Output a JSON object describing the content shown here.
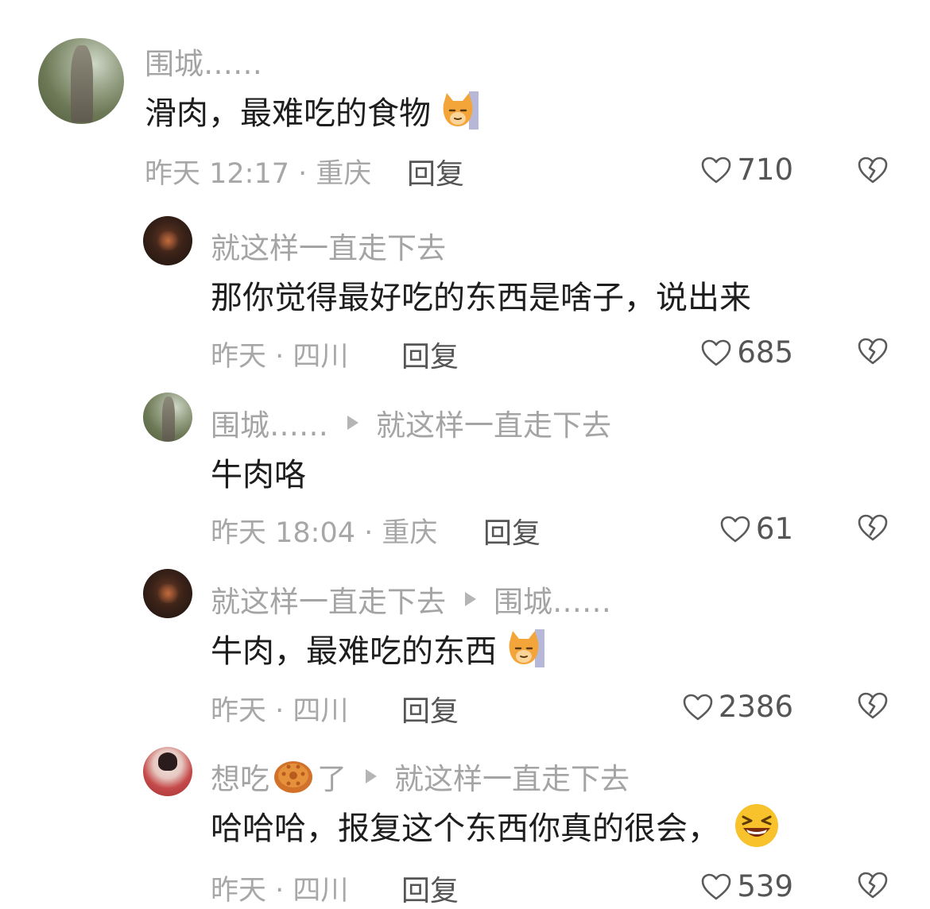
{
  "comments": [
    {
      "author": "围城……",
      "reply_to": "",
      "text": "滑肉，最难吃的食物",
      "time_location": "昨天 12:17 · 重庆",
      "reply_label": "回复",
      "likes": "710",
      "emoji": "cat-face-emoji"
    },
    {
      "author": "就这样一直走下去",
      "reply_to": "",
      "text": "那你觉得最好吃的东西是啥子，说出来",
      "time_location": "昨天 · 四川",
      "reply_label": "回复",
      "likes": "685"
    },
    {
      "author": "围城……",
      "reply_to": "就这样一直走下去",
      "text": "牛肉咯",
      "time_location": "昨天 18:04 · 重庆",
      "reply_label": "回复",
      "likes": "61"
    },
    {
      "author": "就这样一直走下去",
      "reply_to": "围城……",
      "text": "牛肉，最难吃的东西",
      "time_location": "昨天 · 四川",
      "reply_label": "回复",
      "likes": "2386",
      "emoji": "cat-face-emoji"
    },
    {
      "author_part1": "想吃",
      "author_part2": "了",
      "author_emoji": "mooncake-emoji",
      "reply_to": "就这样一直走下去",
      "text": "哈哈哈，报复这个东西你真的很会，",
      "time_location": "昨天 · 四川",
      "reply_label": "回复",
      "likes": "539",
      "emoji": "laughing-face-emoji"
    }
  ],
  "icons": {
    "like": "heart-outline-icon",
    "dislike": "broken-heart-icon"
  },
  "colors": {
    "meta_text": "#a4a4a4",
    "body_text": "#1d1d1d",
    "action_text": "#555555"
  }
}
